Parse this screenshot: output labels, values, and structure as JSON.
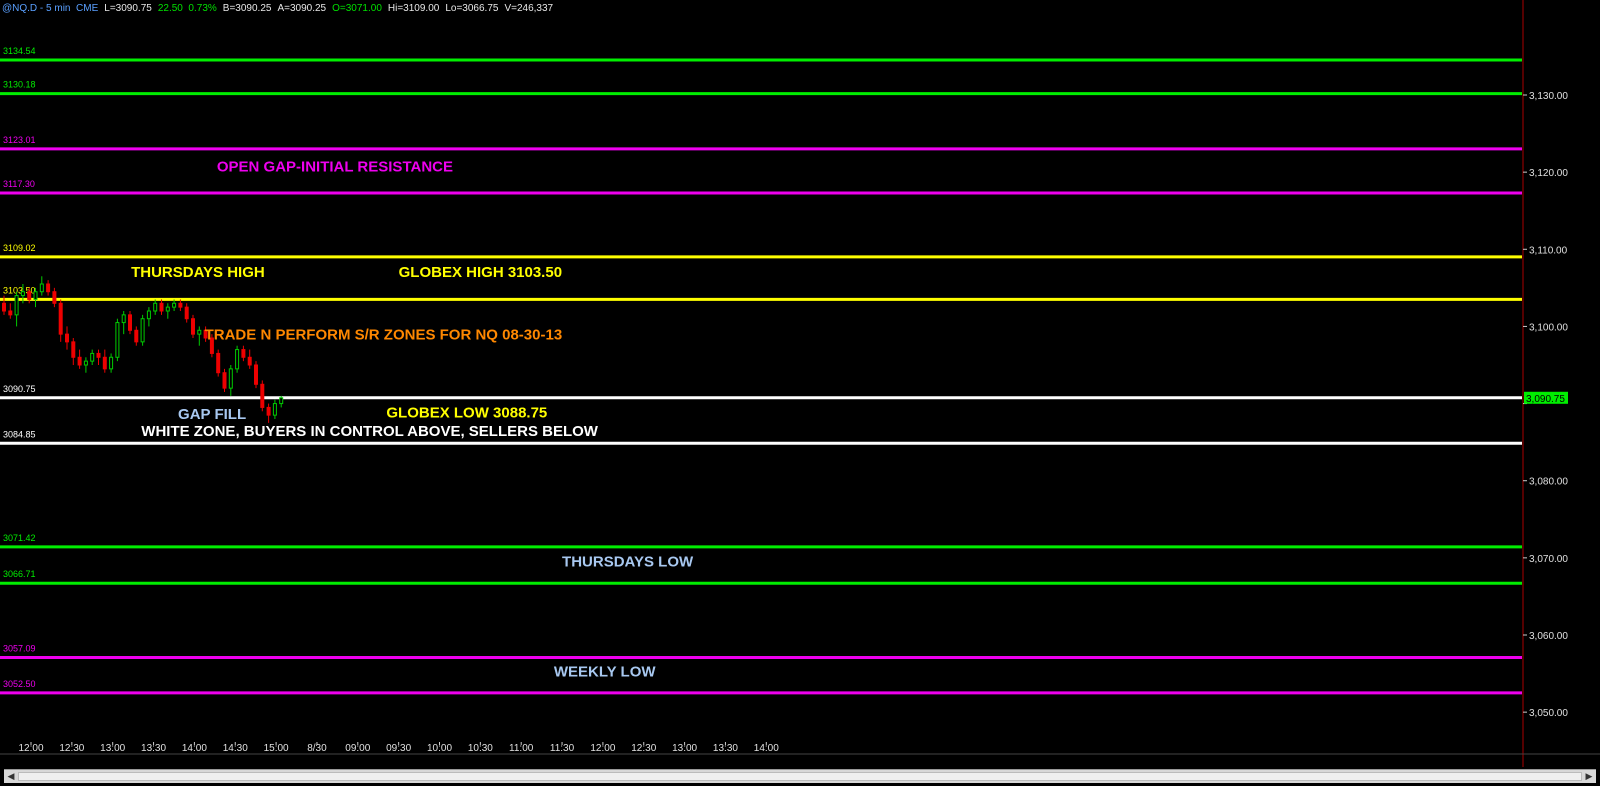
{
  "header": {
    "symbol": "@NQ.D - 5 min  CME",
    "last": "L=3090.75",
    "change": "22.50  0.73%",
    "bid": "B=3090.25",
    "ask": "A=3090.25",
    "open": "O=3071.00",
    "high": "Hi=3109.00",
    "low": "Lo=3066.75",
    "volume": "V=246,337"
  },
  "colors": {
    "background": "#000000",
    "green": "#00ee00",
    "magenta": "#ee00ee",
    "yellow": "#ffff00",
    "white": "#ffffff",
    "orange": "#ff8800",
    "lightblue": "#a8c8f0",
    "candle_up": "#00cc00",
    "candle_down": "#ee0000",
    "axis_border": "#aa0000"
  },
  "chart_data": {
    "type": "candlestick",
    "ylim": [
      3046,
      3140.5
    ],
    "y_ticks": [
      {
        "value": 3050,
        "label": "3,050.00"
      },
      {
        "value": 3060,
        "label": "3,060.00"
      },
      {
        "value": 3070,
        "label": "3,070.00"
      },
      {
        "value": 3080,
        "label": "3,080.00"
      },
      {
        "value": 3090,
        "label": ""
      },
      {
        "value": 3100,
        "label": "3,100.00"
      },
      {
        "value": 3110,
        "label": "3,110.00"
      },
      {
        "value": 3120,
        "label": "3,120.00"
      },
      {
        "value": 3130,
        "label": "3,130.00"
      }
    ],
    "x_ticks": [
      "12:00",
      "12:30",
      "13:00",
      "13:30",
      "14:00",
      "14:30",
      "15:00",
      "8/30",
      "09:00",
      "09:30",
      "10:00",
      "10:30",
      "11:00",
      "11:30",
      "12:00",
      "12:30",
      "13:00",
      "13:30",
      "14:00"
    ],
    "last_price": {
      "value": 3090.75,
      "label": "3,090.75"
    },
    "levels": [
      {
        "price": 3134.54,
        "label": "3134.54",
        "color": "green"
      },
      {
        "price": 3130.18,
        "label": "3130.18",
        "color": "green"
      },
      {
        "price": 3123.01,
        "label": "3123.01",
        "color": "magenta"
      },
      {
        "price": 3117.3,
        "label": "3117.30",
        "color": "magenta"
      },
      {
        "price": 3109.02,
        "label": "3109.02",
        "color": "yellow"
      },
      {
        "price": 3103.5,
        "label": "3103.50",
        "color": "yellow"
      },
      {
        "price": 3090.75,
        "label": "3090.75",
        "color": "white"
      },
      {
        "price": 3084.85,
        "label": "3084.85",
        "color": "white"
      },
      {
        "price": 3071.42,
        "label": "3071.42",
        "color": "green"
      },
      {
        "price": 3066.71,
        "label": "3066.71",
        "color": "green"
      },
      {
        "price": 3057.09,
        "label": "3057.09",
        "color": "magenta"
      },
      {
        "price": 3052.5,
        "label": "3052.50",
        "color": "magenta"
      }
    ],
    "annotations": [
      {
        "text": "OPEN GAP-INITIAL RESISTANCE",
        "price": 3120.1,
        "x_tick": 4.55,
        "color": "magenta"
      },
      {
        "text": "THURSDAYS HIGH",
        "price": 3106.4,
        "x_tick": 2.45,
        "color": "yellow"
      },
      {
        "text": "GLOBEX HIGH 3103.50",
        "price": 3106.4,
        "x_tick": 9.0,
        "color": "yellow"
      },
      {
        "text": "TRADE N PERFORM S/R ZONES FOR NQ 08-30-13",
        "price": 3098.3,
        "x_tick": 4.25,
        "color": "orange"
      },
      {
        "text": "GAP FILL",
        "price": 3088.0,
        "x_tick": 3.6,
        "color": "lightblue"
      },
      {
        "text": "GLOBEX LOW 3088.75",
        "price": 3088.2,
        "x_tick": 8.7,
        "color": "yellow"
      },
      {
        "text": "WHITE ZONE, BUYERS IN CONTROL ABOVE, SELLERS BELOW",
        "price": 3085.8,
        "x_tick": 2.7,
        "color": "white"
      },
      {
        "text": "THURSDAYS LOW",
        "price": 3068.9,
        "x_tick": 13.0,
        "color": "lightblue"
      },
      {
        "text": "WEEKLY LOW",
        "price": 3054.6,
        "x_tick": 12.8,
        "color": "lightblue"
      }
    ],
    "candles": [
      [
        3103.0,
        3104.0,
        3101.5,
        3102.0
      ],
      [
        3102.0,
        3103.0,
        3101.0,
        3101.5
      ],
      [
        3101.5,
        3104.5,
        3100.0,
        3104.0
      ],
      [
        3104.0,
        3105.5,
        3103.0,
        3104.5
      ],
      [
        3104.5,
        3105.0,
        3103.0,
        3103.5
      ],
      [
        3103.5,
        3105.0,
        3102.5,
        3104.5
      ],
      [
        3104.5,
        3106.5,
        3104.0,
        3105.5
      ],
      [
        3105.5,
        3106.0,
        3104.0,
        3104.5
      ],
      [
        3104.5,
        3105.0,
        3102.5,
        3103.0
      ],
      [
        3103.0,
        3103.5,
        3098.0,
        3099.0
      ],
      [
        3099.0,
        3100.0,
        3097.0,
        3098.0
      ],
      [
        3098.0,
        3098.5,
        3095.0,
        3096.0
      ],
      [
        3096.0,
        3097.0,
        3094.5,
        3095.0
      ],
      [
        3095.0,
        3096.0,
        3094.0,
        3095.5
      ],
      [
        3095.5,
        3097.0,
        3095.0,
        3096.5
      ],
      [
        3096.5,
        3097.0,
        3095.0,
        3096.0
      ],
      [
        3096.0,
        3097.0,
        3094.0,
        3094.5
      ],
      [
        3094.5,
        3096.5,
        3094.0,
        3096.0
      ],
      [
        3096.0,
        3101.0,
        3095.5,
        3100.5
      ],
      [
        3100.5,
        3102.0,
        3099.0,
        3101.5
      ],
      [
        3101.5,
        3102.0,
        3099.0,
        3099.5
      ],
      [
        3099.5,
        3100.0,
        3097.5,
        3098.0
      ],
      [
        3098.0,
        3101.5,
        3097.5,
        3101.0
      ],
      [
        3101.0,
        3102.5,
        3100.0,
        3102.0
      ],
      [
        3102.0,
        3103.5,
        3101.5,
        3103.0
      ],
      [
        3103.0,
        3103.5,
        3101.5,
        3102.0
      ],
      [
        3102.0,
        3103.0,
        3101.0,
        3102.5
      ],
      [
        3102.5,
        3103.5,
        3102.0,
        3103.0
      ],
      [
        3103.0,
        3103.5,
        3102.0,
        3102.5
      ],
      [
        3102.5,
        3103.0,
        3100.5,
        3101.0
      ],
      [
        3101.0,
        3101.5,
        3098.5,
        3099.0
      ],
      [
        3099.0,
        3100.0,
        3097.5,
        3099.5
      ],
      [
        3099.5,
        3100.0,
        3098.0,
        3098.5
      ],
      [
        3098.5,
        3099.0,
        3096.0,
        3096.5
      ],
      [
        3096.5,
        3097.0,
        3093.5,
        3094.0
      ],
      [
        3094.0,
        3094.5,
        3091.5,
        3092.0
      ],
      [
        3092.0,
        3095.0,
        3091.0,
        3094.5
      ],
      [
        3094.5,
        3097.5,
        3094.0,
        3097.0
      ],
      [
        3097.0,
        3097.5,
        3095.5,
        3096.0
      ],
      [
        3096.0,
        3097.0,
        3094.5,
        3095.0
      ],
      [
        3095.0,
        3095.5,
        3092.0,
        3092.5
      ],
      [
        3092.5,
        3093.0,
        3089.0,
        3089.5
      ],
      [
        3089.5,
        3090.0,
        3087.5,
        3088.5
      ],
      [
        3088.5,
        3090.5,
        3088.0,
        3090.0
      ],
      [
        3090.0,
        3091.0,
        3089.5,
        3090.75
      ]
    ]
  }
}
